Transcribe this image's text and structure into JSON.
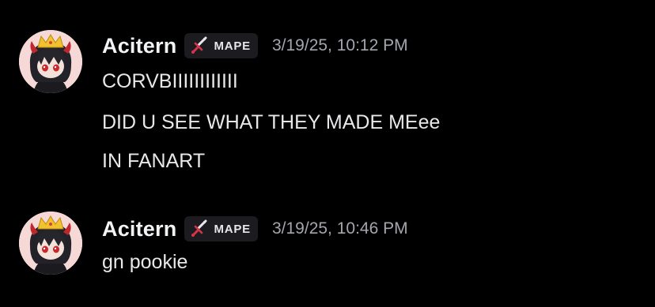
{
  "messages": [
    {
      "username": "Acitern",
      "tag": "MAPE",
      "timestamp": "3/19/25, 10:12 PM",
      "lines": [
        "CORVBIIIIIIIIIIII",
        "DID U SEE WHAT THEY MADE MEee",
        "IN FANART"
      ]
    },
    {
      "username": "Acitern",
      "tag": "MAPE",
      "timestamp": "3/19/25, 10:46 PM",
      "lines": [
        "gn pookie"
      ]
    }
  ],
  "icons": {
    "avatar": "avatar-crowned-character",
    "tag": "sword-icon"
  },
  "colors": {
    "background": "#000000",
    "tag_bg": "#1c1c20",
    "timestamp": "#a3a6ad",
    "avatar_bg": "#f6d9d6"
  }
}
